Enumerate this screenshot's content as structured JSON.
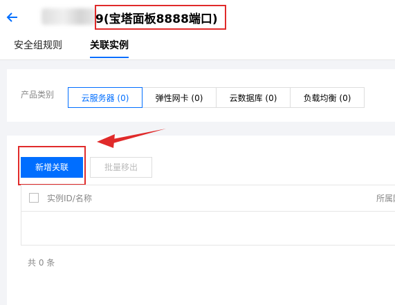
{
  "header": {
    "title": "9(宝塔面板8888端口)",
    "tabs": [
      {
        "label": "安全组规则"
      },
      {
        "label": "关联实例"
      }
    ]
  },
  "filter": {
    "label": "产品类别",
    "options": [
      {
        "label": "云服务器 (0)"
      },
      {
        "label": "弹性网卡 (0)"
      },
      {
        "label": "云数据库 (0)"
      },
      {
        "label": "负载均衡 (0)"
      }
    ],
    "selected": "云服务器 (0)"
  },
  "toolbar": {
    "add_label": "新增关联",
    "batch_remove_label": "批量移出"
  },
  "table": {
    "columns": [
      "实例ID/名称",
      "所属网"
    ],
    "rows": []
  },
  "footer": {
    "total_text": "共 0 条"
  },
  "colors": {
    "accent": "#006eff",
    "annotation": "#e02a2a"
  }
}
